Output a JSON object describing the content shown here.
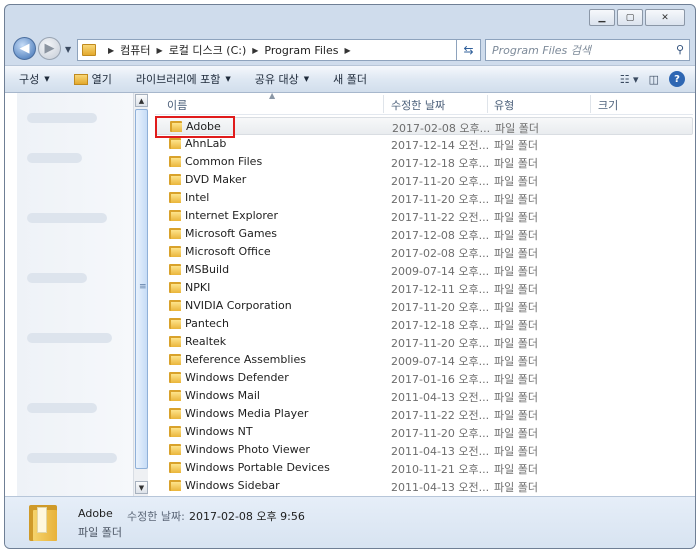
{
  "address": {
    "crumbs": [
      "컴퓨터",
      "로컬 디스크 (C:)",
      "Program Files"
    ]
  },
  "search": {
    "placeholder": "Program Files 검색"
  },
  "toolbar": {
    "organize": "구성",
    "open": "열기",
    "include_library": "라이브러리에 포함",
    "share": "공유 대상",
    "new_folder": "새 폴더"
  },
  "columns": {
    "name": "이름",
    "modified": "수정한 날짜",
    "type": "유형",
    "size": "크기"
  },
  "files": [
    {
      "name": "Adobe",
      "date": "2017-02-08 오후...",
      "type": "파일 폴더"
    },
    {
      "name": "AhnLab",
      "date": "2017-12-14 오전...",
      "type": "파일 폴더"
    },
    {
      "name": "Common Files",
      "date": "2017-12-18 오후...",
      "type": "파일 폴더"
    },
    {
      "name": "DVD Maker",
      "date": "2017-11-20 오후...",
      "type": "파일 폴더"
    },
    {
      "name": "Intel",
      "date": "2017-11-20 오후...",
      "type": "파일 폴더"
    },
    {
      "name": "Internet Explorer",
      "date": "2017-11-22 오전...",
      "type": "파일 폴더"
    },
    {
      "name": "Microsoft Games",
      "date": "2017-12-08 오후...",
      "type": "파일 폴더"
    },
    {
      "name": "Microsoft Office",
      "date": "2017-02-08 오후...",
      "type": "파일 폴더"
    },
    {
      "name": "MSBuild",
      "date": "2009-07-14 오후...",
      "type": "파일 폴더"
    },
    {
      "name": "NPKI",
      "date": "2017-12-11 오후...",
      "type": "파일 폴더"
    },
    {
      "name": "NVIDIA Corporation",
      "date": "2017-11-20 오후...",
      "type": "파일 폴더"
    },
    {
      "name": "Pantech",
      "date": "2017-12-18 오후...",
      "type": "파일 폴더"
    },
    {
      "name": "Realtek",
      "date": "2017-11-20 오후...",
      "type": "파일 폴더"
    },
    {
      "name": "Reference Assemblies",
      "date": "2009-07-14 오후...",
      "type": "파일 폴더"
    },
    {
      "name": "Windows Defender",
      "date": "2017-01-16 오후...",
      "type": "파일 폴더"
    },
    {
      "name": "Windows Mail",
      "date": "2011-04-13 오전...",
      "type": "파일 폴더"
    },
    {
      "name": "Windows Media Player",
      "date": "2017-11-22 오전...",
      "type": "파일 폴더"
    },
    {
      "name": "Windows NT",
      "date": "2017-11-20 오후...",
      "type": "파일 폴더"
    },
    {
      "name": "Windows Photo Viewer",
      "date": "2011-04-13 오전...",
      "type": "파일 폴더"
    },
    {
      "name": "Windows Portable Devices",
      "date": "2010-11-21 오후...",
      "type": "파일 폴더"
    },
    {
      "name": "Windows Sidebar",
      "date": "2011-04-13 오전...",
      "type": "파일 폴더"
    }
  ],
  "selected_index": 0,
  "details": {
    "name": "Adobe",
    "type": "파일 폴더",
    "modified_label": "수정한 날짜:",
    "modified_value": "2017-02-08 오후 9:56"
  },
  "colors": {
    "highlight_box": "#e01b1b",
    "window_frame": "#cfdcec"
  }
}
